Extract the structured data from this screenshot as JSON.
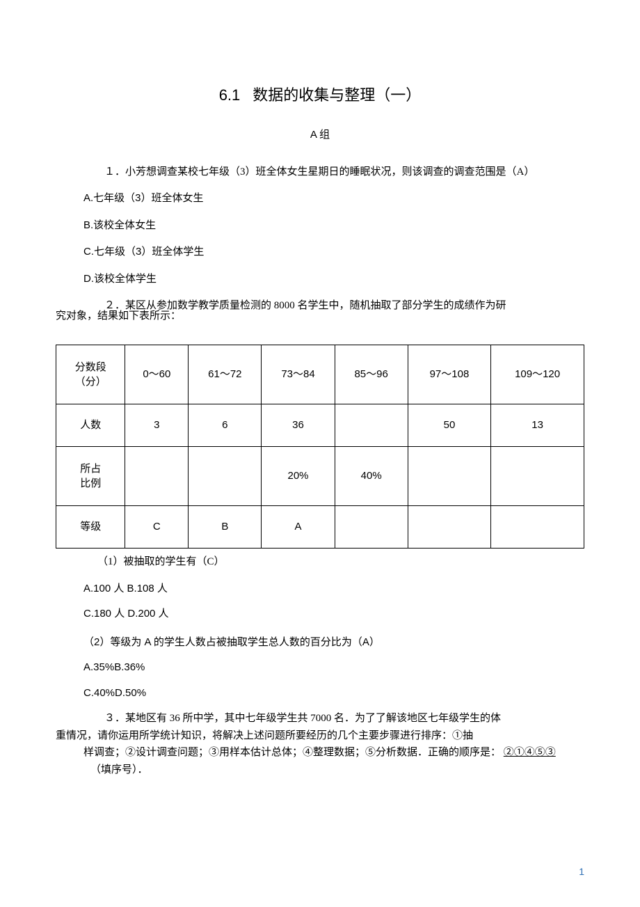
{
  "title": {
    "num": "6.1",
    "text": "数据的收集与整理（一）"
  },
  "group": "A 组",
  "q1": {
    "stem": "１．小芳想调查某校七年级（3）班全体女生星期日的睡眠状况，则该调查的调查范围是（A）",
    "A": "A.七年级（3）班全体女生",
    "B": "B.该校全体女生",
    "C": "C.七年级（3）班全体学生",
    "D": "D.该校全体学生"
  },
  "q2": {
    "stem": "２．某区从参加数学教学质量检测的 8000 名学生中，随机抽取了部分学生的成绩作为研",
    "stem_cont": "究对象，结果如下表所示：",
    "table": {
      "headers": {
        "col0_l1": "分数段",
        "col0_l2": "（分）",
        "c1": "0～60",
        "c2": "61～72",
        "c3": "73～84",
        "c4": "85～96",
        "c5": "97～108",
        "c6": "109～120"
      },
      "row_count": {
        "label": "人数",
        "v1": "3",
        "v2": "6",
        "v3": "36",
        "v4": "",
        "v5": "50",
        "v6": "13"
      },
      "row_pct": {
        "label_l1": "所占",
        "label_l2": "比例",
        "v1": "",
        "v2": "",
        "v3": "20%",
        "v4": "40%",
        "v5": "",
        "v6": ""
      },
      "row_grade": {
        "label": "等级",
        "v1": "C",
        "v2": "B",
        "v3": "A",
        "v4": "",
        "v5": "",
        "v6": ""
      }
    },
    "sub1": {
      "stem": "（1）被抽取的学生有（C）",
      "opt1": "A.100 人 B.108 人",
      "opt2": "C.180 人 D.200 人"
    },
    "sub2": {
      "stem": "（2）等级为 A 的学生人数占被抽取学生总人数的百分比为（A）",
      "opt1": "A.35%B.36%",
      "opt2": "C.40%D.50%"
    }
  },
  "q3": {
    "l1": "３．某地区有 36 所中学，其中七年级学生共 7000 名．为了了解该地区七年级学生的体",
    "l2": "重情况，请你运用所学统计知识，将解决上述问题所要经历的几个主要步骤进行排序：①抽",
    "l3_a": "样调查；②设计调查问题；③用样本估计总体；④整理数据；⑤分析数据．正确的顺序是：",
    "answer": "②①④⑤③",
    "l4": "（填序号）．"
  },
  "page_number": "1"
}
